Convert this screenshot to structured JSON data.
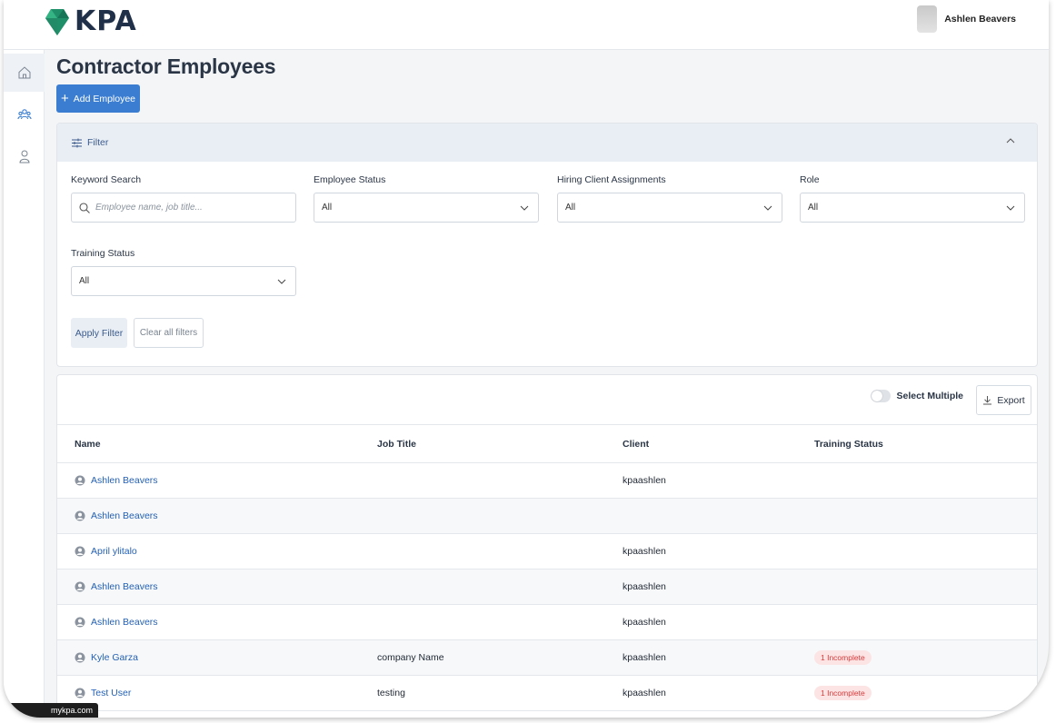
{
  "header": {
    "logo_text": "KPA",
    "user_name": "Ashlen Beavers"
  },
  "sidebar": {
    "items": [
      {
        "icon": "home-icon",
        "active": true
      },
      {
        "icon": "users-icon",
        "active": false
      },
      {
        "icon": "person-icon",
        "active": false
      }
    ]
  },
  "page": {
    "title": "Contractor Employees",
    "add_button": "Add Employee"
  },
  "filter": {
    "title": "Filter",
    "keyword_label": "Keyword Search",
    "keyword_placeholder": "Employee name, job title...",
    "employee_status_label": "Employee Status",
    "employee_status_value": "All",
    "hiring_label": "Hiring Client Assignments",
    "hiring_value": "All",
    "role_label": "Role",
    "role_value": "All",
    "training_label": "Training Status",
    "training_value": "All",
    "apply_button": "Apply Filter",
    "clear_button": "Clear all filters"
  },
  "table": {
    "select_multiple_label": "Select Multiple",
    "export_label": "Export",
    "columns": [
      "Name",
      "Job Title",
      "Client",
      "Training Status"
    ],
    "rows": [
      {
        "name": "Ashlen Beavers",
        "job_title": "",
        "client": "kpaashlen",
        "training": ""
      },
      {
        "name": "Ashlen Beavers",
        "job_title": "",
        "client": "",
        "training": ""
      },
      {
        "name": "April ylitalo",
        "job_title": "",
        "client": "kpaashlen",
        "training": ""
      },
      {
        "name": "Ashlen Beavers",
        "job_title": "",
        "client": "kpaashlen",
        "training": ""
      },
      {
        "name": "Ashlen Beavers",
        "job_title": "",
        "client": "kpaashlen",
        "training": ""
      },
      {
        "name": "Kyle Garza",
        "job_title": "company Name",
        "client": "kpaashlen",
        "training": "1 Incomplete"
      },
      {
        "name": "Test User",
        "job_title": "testing",
        "client": "kpaashlen",
        "training": "1 Incomplete"
      }
    ]
  },
  "status_bar": {
    "url": "mykpa.com"
  },
  "colors": {
    "primary": "#3b7ed1",
    "link": "#2461b5",
    "badge_bg": "#fde4e4",
    "badge_text": "#d63b3b",
    "logo_green": "#1f8f6a"
  }
}
